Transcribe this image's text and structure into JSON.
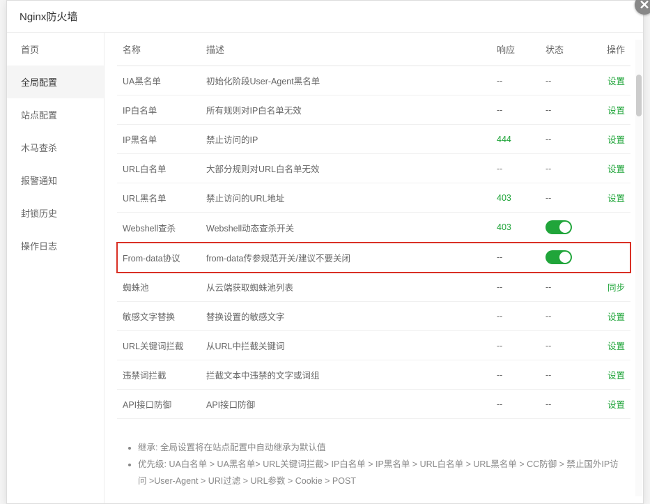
{
  "title": "Nginx防火墙",
  "close": "✕",
  "sidebar": {
    "items": [
      {
        "label": "首页"
      },
      {
        "label": "全局配置"
      },
      {
        "label": "站点配置"
      },
      {
        "label": "木马查杀"
      },
      {
        "label": "报警通知"
      },
      {
        "label": "封锁历史"
      },
      {
        "label": "操作日志"
      }
    ]
  },
  "table": {
    "headers": {
      "name": "名称",
      "desc": "描述",
      "resp": "响应",
      "status": "状态",
      "action": "操作"
    },
    "rows": [
      {
        "name": "UA黑名单",
        "desc": "初始化阶段User-Agent黑名单",
        "resp": "--",
        "resp_green": false,
        "status": "--",
        "status_toggle": false,
        "action": "设置"
      },
      {
        "name": "IP白名单",
        "desc": "所有规则对IP白名单无效",
        "resp": "--",
        "resp_green": false,
        "status": "--",
        "status_toggle": false,
        "action": "设置"
      },
      {
        "name": "IP黑名单",
        "desc": "禁止访问的IP",
        "resp": "444",
        "resp_green": true,
        "status": "--",
        "status_toggle": false,
        "action": "设置"
      },
      {
        "name": "URL白名单",
        "desc": "大部分规则对URL白名单无效",
        "resp": "--",
        "resp_green": false,
        "status": "--",
        "status_toggle": false,
        "action": "设置"
      },
      {
        "name": "URL黑名单",
        "desc": "禁止访问的URL地址",
        "resp": "403",
        "resp_green": true,
        "status": "--",
        "status_toggle": false,
        "action": "设置"
      },
      {
        "name": "Webshell查杀",
        "desc": "Webshell动态查杀开关",
        "resp": "403",
        "resp_green": true,
        "status": "on",
        "status_toggle": true,
        "action": ""
      },
      {
        "name": "From-data协议",
        "desc": "from-data传参规范开关/建议不要关闭",
        "resp": "--",
        "resp_green": false,
        "status": "on",
        "status_toggle": true,
        "action": "",
        "highlight": true
      },
      {
        "name": "蜘蛛池",
        "desc": "从云端获取蜘蛛池列表",
        "resp": "--",
        "resp_green": false,
        "status": "--",
        "status_toggle": false,
        "action": "同步"
      },
      {
        "name": "敏感文字替换",
        "desc": "替换设置的敏感文字",
        "resp": "--",
        "resp_green": false,
        "status": "--",
        "status_toggle": false,
        "action": "设置"
      },
      {
        "name": "URL关键词拦截",
        "desc": "从URL中拦截关键词",
        "resp": "--",
        "resp_green": false,
        "status": "--",
        "status_toggle": false,
        "action": "设置"
      },
      {
        "name": "违禁词拦截",
        "desc": "拦截文本中违禁的文字或词组",
        "resp": "--",
        "resp_green": false,
        "status": "--",
        "status_toggle": false,
        "action": "设置"
      },
      {
        "name": "API接口防御",
        "desc": "API接口防御",
        "resp": "--",
        "resp_green": false,
        "status": "--",
        "status_toggle": false,
        "action": "设置"
      }
    ]
  },
  "notes": {
    "line1": "继承: 全局设置将在站点配置中自动继承为默认值",
    "line2": "优先级: UA白名单 > UA黑名单> URL关键词拦截> IP白名单 > IP黑名单 > URL白名单 > URL黑名单 > CC防御 > 禁止国外IP访问 >User-Agent > URI过滤 > URL参数 > Cookie > POST"
  }
}
